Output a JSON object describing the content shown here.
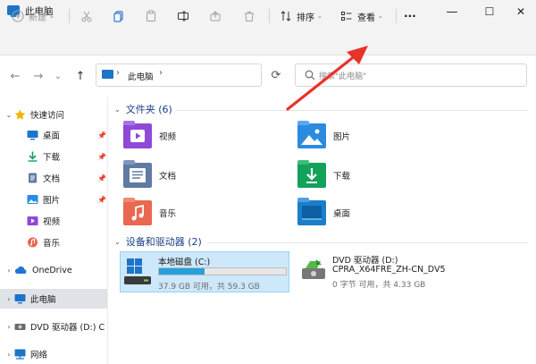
{
  "window": {
    "title": "此电脑",
    "minimize": "—",
    "maximize": "☐",
    "close": "✕"
  },
  "toolbar": {
    "new_label": "新建",
    "sort_label": "排序",
    "view_label": "查看",
    "more_label": "···"
  },
  "navigation": {
    "back": "←",
    "forward": "→",
    "recent": "⌄",
    "up": "↑",
    "address_location": "此电脑",
    "address_chevron": "›",
    "refresh": "⟳",
    "search_placeholder": "搜索\"此电脑\""
  },
  "sidebar": {
    "quick_access": "快速访问",
    "quick_items": [
      {
        "label": "桌面",
        "icon": "desktop-icon",
        "pinned": true
      },
      {
        "label": "下载",
        "icon": "download-icon",
        "pinned": true
      },
      {
        "label": "文档",
        "icon": "documents-icon",
        "pinned": true
      },
      {
        "label": "图片",
        "icon": "pictures-icon",
        "pinned": true
      },
      {
        "label": "视频",
        "icon": "videos-icon",
        "pinned": false
      },
      {
        "label": "音乐",
        "icon": "music-icon",
        "pinned": false
      }
    ],
    "onedrive": "OneDrive",
    "this_pc": "此电脑",
    "dvd": "DVD 驱动器 (D:) C",
    "network": "网络"
  },
  "content": {
    "folders_header": "文件夹 (6)",
    "folders": [
      {
        "label": "视频",
        "icon": "videos-folder-icon",
        "color": "#8e4ad6"
      },
      {
        "label": "图片",
        "icon": "pictures-folder-icon",
        "color": "#2b8be0"
      },
      {
        "label": "文档",
        "icon": "documents-folder-icon",
        "color": "#5f7aa3"
      },
      {
        "label": "下载",
        "icon": "downloads-folder-icon",
        "color": "#13a25a"
      },
      {
        "label": "音乐",
        "icon": "music-folder-icon",
        "color": "#e9684f"
      },
      {
        "label": "桌面",
        "icon": "desktop-folder-icon",
        "color": "#1a7fc9"
      }
    ],
    "devices_header": "设备和驱动器 (2)",
    "drives": [
      {
        "name": "本地磁盘 (C:)",
        "detail": "37.9 GB 可用，共 59.3 GB",
        "used_fraction": 0.36,
        "selected": true
      },
      {
        "name": "DVD 驱动器 (D:)",
        "volume": "CPRA_X64FRE_ZH-CN_DV5",
        "detail": "0 字节 可用，共 4.33 GB",
        "selected": false
      }
    ]
  },
  "colors": {
    "accent": "#0067c0",
    "selection_bg": "#cde8fb",
    "selection_border": "#99d1f7",
    "drive_bar": "#26a0da",
    "annotation_arrow": "#e8332a"
  }
}
